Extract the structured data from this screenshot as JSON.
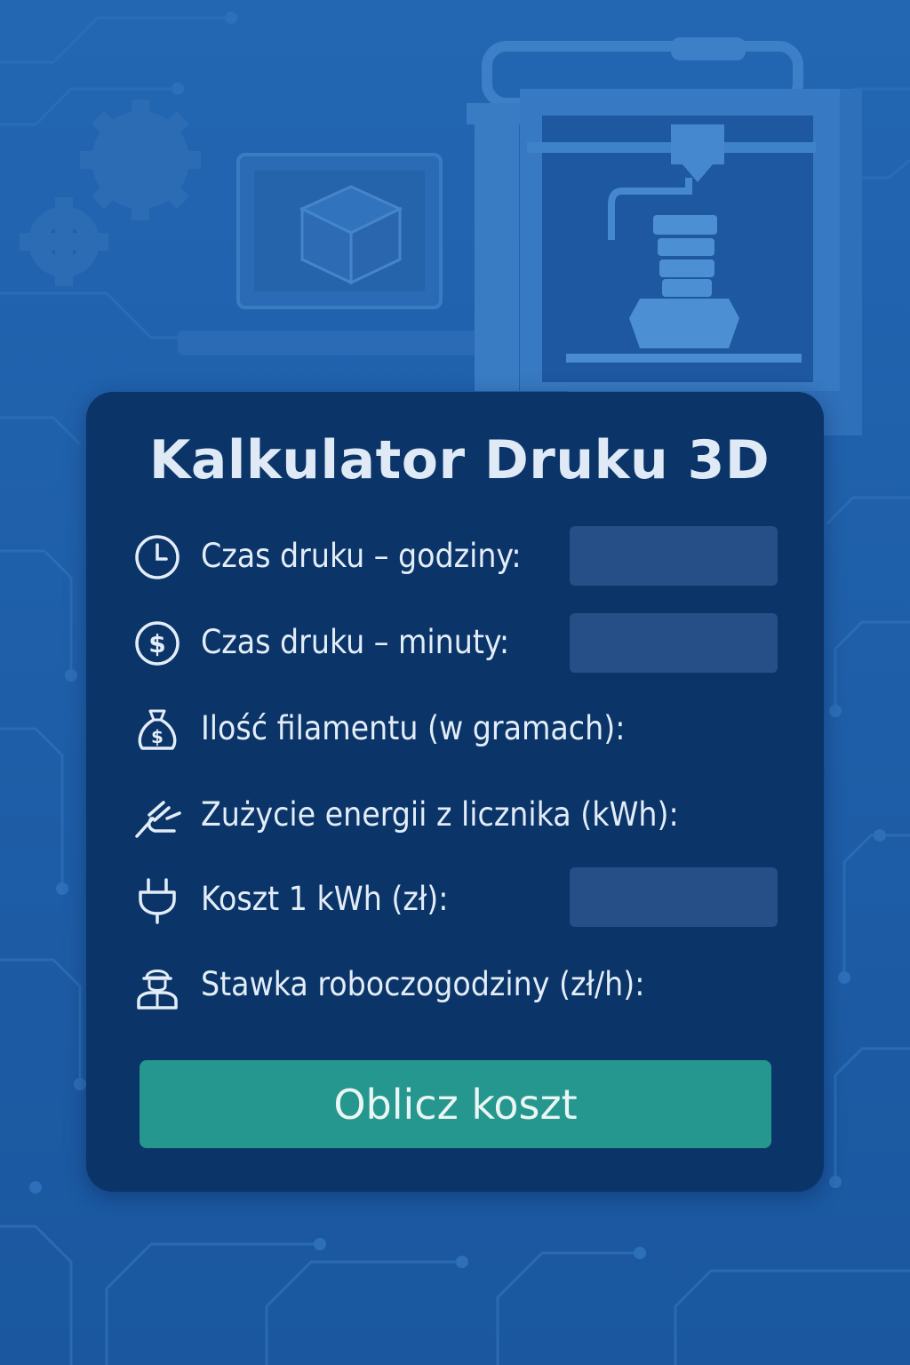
{
  "form": {
    "title": "Kalkulator Druku 3D",
    "fields": [
      {
        "label": "Czas druku – godziny:",
        "icon": "clock-icon",
        "value": ""
      },
      {
        "label": "Czas druku – minuty:",
        "icon": "dollar-coin-icon",
        "value": ""
      },
      {
        "label": "Ilość filamentu (w gramach):",
        "icon": "money-bag-icon"
      },
      {
        "label": "Zużycie energii z licznika (kWh):",
        "icon": "energy-meter-icon"
      },
      {
        "label": "Koszt 1 kWh (zł):",
        "icon": "plug-icon",
        "value": ""
      },
      {
        "label": "Stawka roboczogodziny (zł/h):",
        "icon": "worker-icon"
      }
    ],
    "submit_label": "Oblicz koszt"
  },
  "colors": {
    "background": "#1b5aa3",
    "card": "#0b3468",
    "input": "#264f88",
    "button": "#26978f",
    "text": "#e3edf8"
  }
}
